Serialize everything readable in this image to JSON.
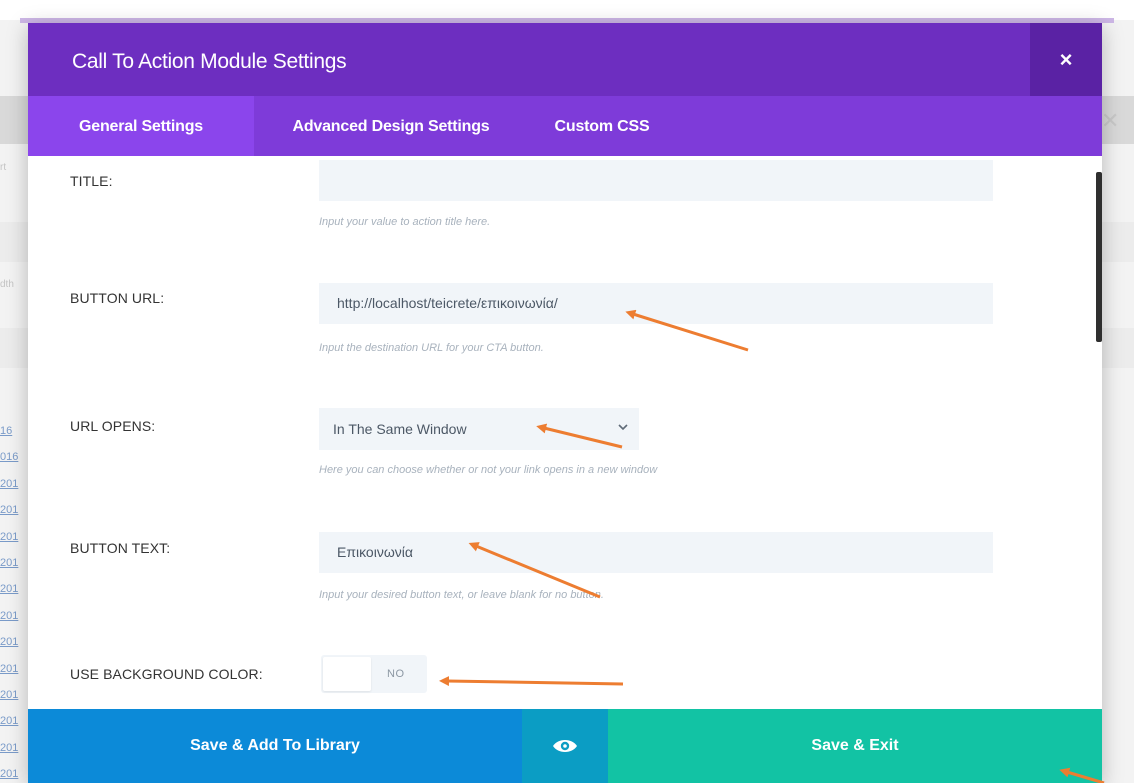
{
  "modal": {
    "title": "Call To Action Module Settings",
    "close_icon": "×"
  },
  "tabs": [
    {
      "label": "General Settings",
      "active": true
    },
    {
      "label": "Advanced Design Settings",
      "active": false
    },
    {
      "label": "Custom CSS",
      "active": false
    }
  ],
  "fields": {
    "title": {
      "label": "TITLE:",
      "value": "",
      "description": "Input your value to action title here."
    },
    "button_url": {
      "label": "BUTTON URL:",
      "value": "http://localhost/teicrete/επικοινωνία/",
      "description": "Input the destination URL for your CTA button."
    },
    "url_opens": {
      "label": "URL OPENS:",
      "value": "In The Same Window",
      "description": "Here you can choose whether or not your link opens in a new window"
    },
    "button_text": {
      "label": "BUTTON TEXT:",
      "value": "Επικοινωνία",
      "description": "Input your desired button text, or leave blank for no button."
    },
    "use_background_color": {
      "label": "USE BACKGROUND COLOR:",
      "value": "NO"
    }
  },
  "footer": {
    "save_library_label": "Save & Add To Library",
    "preview_icon": "eye-icon",
    "save_exit_label": "Save & Exit"
  },
  "background": {
    "link_fragments": [
      "16",
      "016",
      "201",
      "201",
      "201",
      "201",
      "201",
      "201",
      "201",
      "201",
      "201",
      "201",
      "201",
      "201"
    ],
    "side_text_1": "rt",
    "side_text_2": "dth"
  },
  "colors": {
    "header": "#6d2ec0",
    "tabs": "#7e3bd9",
    "active_tab": "#8b45ec",
    "save_library": "#0c8ad8",
    "preview": "#0b9dc4",
    "save_exit": "#12c3a4",
    "annotation_arrow": "#ed7d31"
  }
}
